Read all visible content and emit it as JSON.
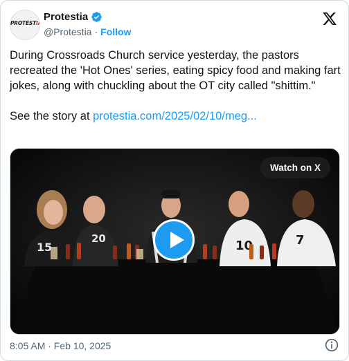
{
  "author": {
    "display_name": "Protestia",
    "handle": "@Protestia",
    "separator": "·",
    "follow_label": "Follow",
    "avatar_text_a": "PROTEST",
    "avatar_text_b": "IA"
  },
  "tweet": {
    "text": "During Crossroads Church service yesterday, the pastors recreated the 'Hot Ones' series, eating spicy food and making fart jokes, along with chuckling about the OT city called \"shittim.\"",
    "link_prefix": "See the story at ",
    "link_text": "protestia.com/2025/02/10/meg..."
  },
  "media": {
    "watch_label": "Watch on X",
    "jerseys": [
      "15",
      "20",
      "10",
      "7"
    ]
  },
  "footer": {
    "timestamp": "8:05 AM · Feb 10, 2025"
  },
  "colors": {
    "accent": "#1d9bf0",
    "secondary_text": "#536471",
    "border": "#cfd9de"
  }
}
